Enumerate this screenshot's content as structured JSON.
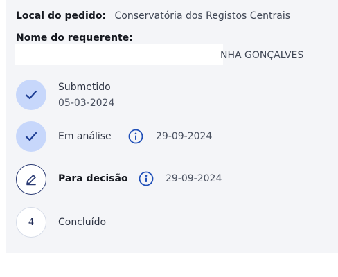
{
  "request": {
    "local_label": "Local do pedido:",
    "local_value": "Conservatória dos Registos Centrais",
    "name_label": "Nome do requerente:",
    "name_value_visible": "NHA GONÇALVES"
  },
  "steps": [
    {
      "title": "Submetido",
      "date": "05-03-2024",
      "state": "done"
    },
    {
      "title": "Em análise",
      "date": "29-09-2024",
      "state": "done"
    },
    {
      "title": "Para decisão",
      "date": "29-09-2024",
      "state": "active"
    },
    {
      "title": "Concluído",
      "number": "4",
      "state": "todo"
    }
  ],
  "colors": {
    "panel_bg": "#f4f5f8",
    "done_circle": "#c7d7fb",
    "accent": "#2a3a73",
    "info_icon": "#1f4fb8"
  }
}
